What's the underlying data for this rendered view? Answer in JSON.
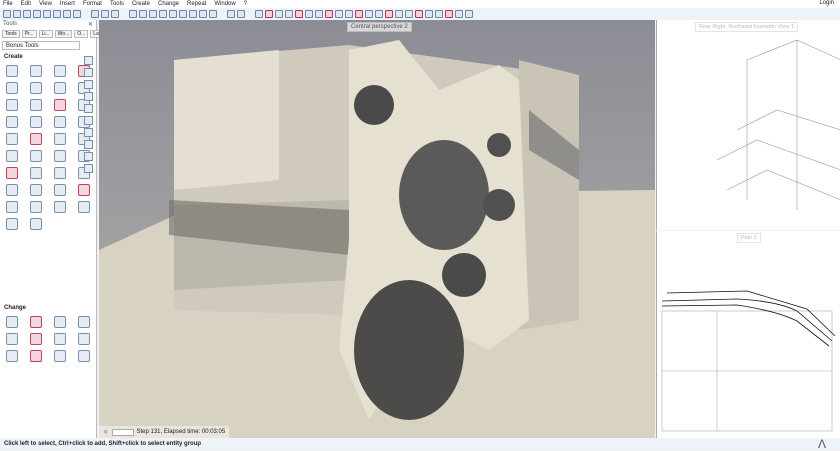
{
  "menu": [
    "File",
    "Edit",
    "View",
    "Insert",
    "Format",
    "Tools",
    "Create",
    "Change",
    "Repeat",
    "Window",
    "?"
  ],
  "login": "Login",
  "tools_panel": {
    "title": "Tools",
    "tabs": [
      "Tools",
      "Pr...",
      "Li...",
      "Wo...",
      "O...",
      "La..."
    ],
    "combo": "Bonus Tools",
    "create_label": "Create",
    "change_label": "Change"
  },
  "viewport": {
    "title": "Central perspective 2",
    "progress_text": "Step 131, Elapsed time: 00:03:05"
  },
  "right_top": {
    "title": "Rear Right, Northeast Isometric View 1"
  },
  "right_bottom": {
    "title": "Plan 2"
  },
  "status": "Click left to select, Ctrl+click to add, Shift+click to select entity group"
}
